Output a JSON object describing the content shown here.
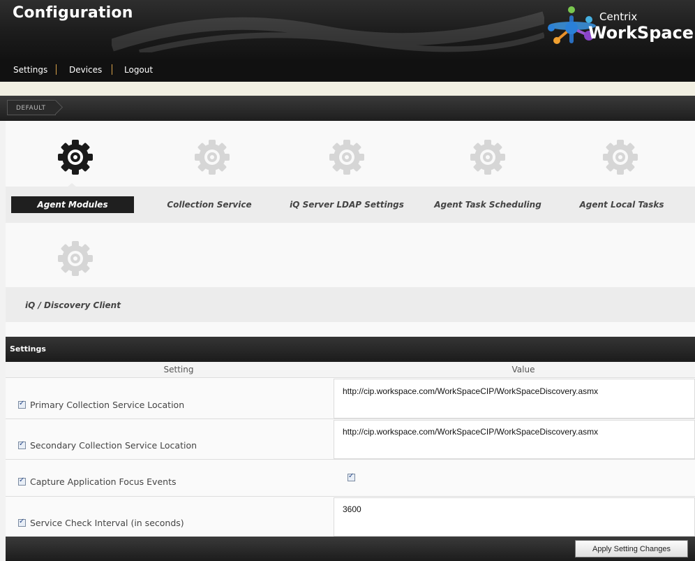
{
  "header": {
    "title": "Configuration",
    "logo_small": "Centrix",
    "logo_big": "WorkSpace"
  },
  "topnav": {
    "items": [
      "Settings",
      "Devices",
      "Logout"
    ]
  },
  "breadcrumb": {
    "label": "DEFAULT"
  },
  "tiles": [
    {
      "label": "Agent Modules",
      "active": true,
      "icon": "gear-icon"
    },
    {
      "label": "Collection Service",
      "active": false,
      "icon": "gear-icon"
    },
    {
      "label": "iQ Server LDAP Settings",
      "active": false,
      "icon": "gear-icon"
    },
    {
      "label": "Agent Task Scheduling",
      "active": false,
      "icon": "gear-icon"
    },
    {
      "label": "Agent Local Tasks",
      "active": false,
      "icon": "gear-icon"
    },
    {
      "label": "iQ / Discovery Client",
      "active": false,
      "icon": "gear-icon"
    }
  ],
  "settings": {
    "title": "Settings",
    "col_setting": "Setting",
    "col_value": "Value",
    "rows": [
      {
        "label": "Primary Collection Service Location",
        "enabled": true,
        "type": "text",
        "value": "http://cip.workspace.com/WorkSpaceCIP/WorkSpaceDiscovery.asmx"
      },
      {
        "label": "Secondary Collection Service Location",
        "enabled": true,
        "type": "text",
        "value": "http://cip.workspace.com/WorkSpaceCIP/WorkSpaceDiscovery.asmx"
      },
      {
        "label": "Capture Application Focus Events",
        "enabled": true,
        "type": "checkbox",
        "value": true
      },
      {
        "label": "Service Check Interval (in seconds)",
        "enabled": true,
        "type": "text",
        "value": "3600"
      }
    ],
    "apply_label": "Apply Setting Changes"
  },
  "colors": {
    "header_bg": "#1c1c1c",
    "active_tile": "#1f1f1f",
    "nav_separator": "#d9a24a",
    "gear_active": "#1a1a1a",
    "gear_inactive": "#d4d4d4"
  }
}
